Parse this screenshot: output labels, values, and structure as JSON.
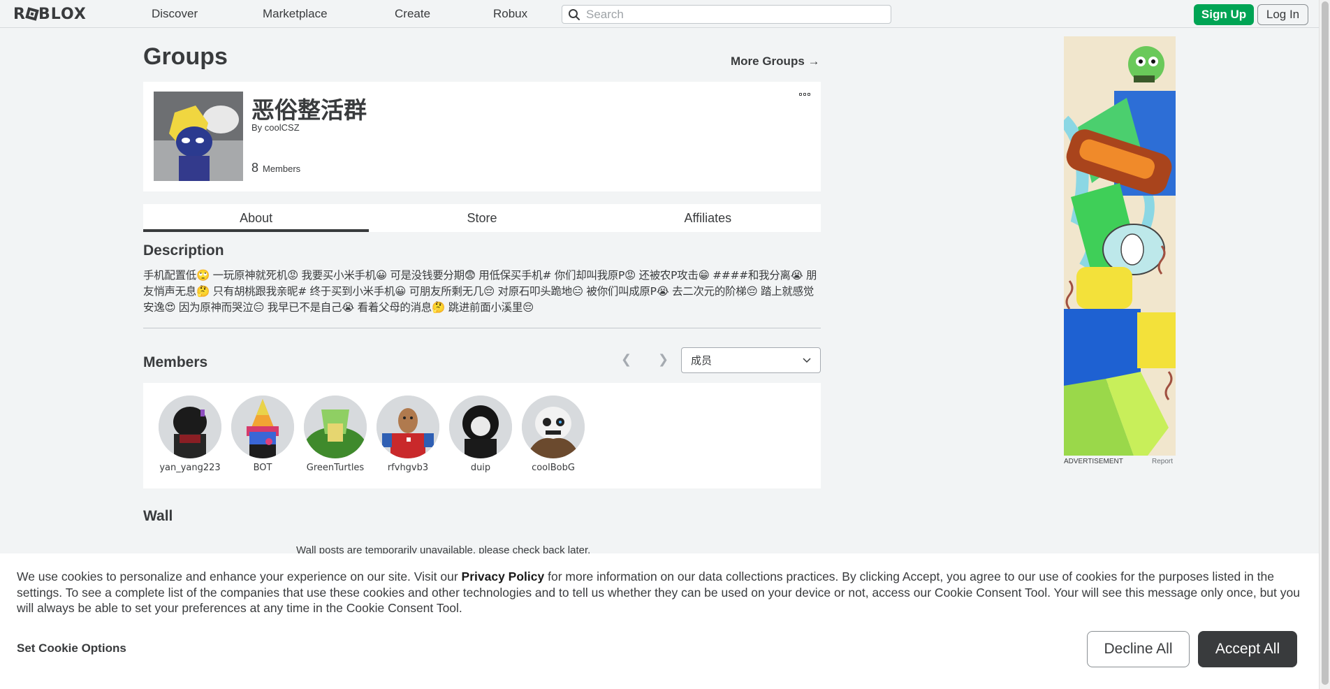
{
  "topbar": {
    "logo": "ROBLOX",
    "nav": [
      "Discover",
      "Marketplace",
      "Create",
      "Robux"
    ],
    "search_placeholder": "Search",
    "signup": "Sign Up",
    "login": "Log In"
  },
  "page": {
    "title": "Groups",
    "more_groups": "More Groups →"
  },
  "group": {
    "name": "恶俗整活群",
    "by_prefix": "By",
    "owner": "coolCSZ",
    "member_count": "8",
    "members_label": "Members"
  },
  "tabs": [
    "About",
    "Store",
    "Affiliates"
  ],
  "description": {
    "heading": "Description",
    "text": "手机配置低🙄 一玩原神就死机😡 我要买小米手机😀 可是没钱要分期😨 用低保买手机# 你们却叫我原P😡 还被农P攻击😁 ####和我分离😭 朋友悄声无息🤔 只有胡桃跟我亲昵# 终于买到小米手机😀 可朋友所剩无几😔 对原石叩头跪地😑 被你们叫成原P😭 去二次元的阶梯😔 踏上就感觉安逸😍 因为原神而哭泣😑 我早已不是自己😭 看着父母的消息🤔 跳进前面小溪里😔"
  },
  "members": {
    "heading": "Members",
    "role_select": "成员",
    "list": [
      {
        "name": "yan_yang223"
      },
      {
        "name": "BOT"
      },
      {
        "name": "GreenTurtles"
      },
      {
        "name": "rfvhgvb3"
      },
      {
        "name": "duip"
      },
      {
        "name": "coolBobG"
      }
    ]
  },
  "wall": {
    "heading": "Wall",
    "note": "Wall posts are temporarily unavailable, please check back later."
  },
  "ad": {
    "label": "ADVERTISEMENT",
    "report": "Report"
  },
  "cookie": {
    "text_before": "We use cookies to personalize and enhance your experience on our site. Visit our ",
    "policy_link": "Privacy Policy",
    "text_after": " for more information on our data collections practices. By clicking Accept, you agree to our use of cookies for the purposes listed in the settings. To see a complete list of the companies that use these cookies and other technologies and to tell us whether they can be used on your device or not, access our Cookie Consent Tool. Your will see this message only once, but you will always be able to set your preferences at any time in the Cookie Consent Tool.",
    "set_options": "Set Cookie Options",
    "decline": "Decline All",
    "accept": "Accept All"
  }
}
